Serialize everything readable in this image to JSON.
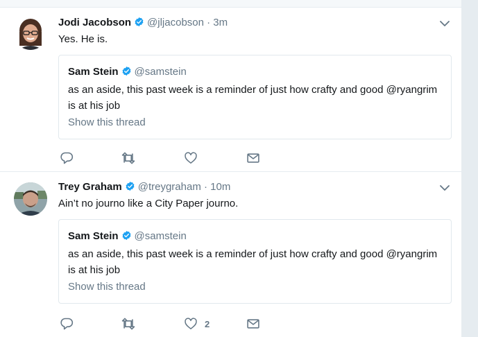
{
  "tweets": [
    {
      "author": {
        "name": "Jodi Jacobson",
        "handle": "@jljacobson",
        "verified": true
      },
      "time": "· 3m",
      "text": "Yes. He is.",
      "quote": {
        "author": {
          "name": "Sam Stein",
          "handle": "@samstein",
          "verified": true
        },
        "text": "as an aside, this past week is a reminder of just how crafty and good @ryangrim is at his job",
        "thread_link": "Show this thread"
      },
      "actions": {
        "reply": "",
        "retweet": "",
        "like": "",
        "dm": ""
      }
    },
    {
      "author": {
        "name": "Trey Graham",
        "handle": "@treygraham",
        "verified": true
      },
      "time": "· 10m",
      "text": "Ain’t no journo like a City Paper journo.",
      "quote": {
        "author": {
          "name": "Sam Stein",
          "handle": "@samstein",
          "verified": true
        },
        "text": "as an aside, this past week is a reminder of just how crafty and good @ryangrim is at his job",
        "thread_link": "Show this thread"
      },
      "actions": {
        "reply": "",
        "retweet": "",
        "like": "2",
        "dm": ""
      }
    }
  ],
  "colors": {
    "verified": "#1da1f2",
    "secondary_text": "#657786",
    "border": "#e1e8ed",
    "background": "#e6ecf0"
  },
  "icons": [
    "verified-badge-icon",
    "caret-down-icon",
    "reply-icon",
    "retweet-icon",
    "like-icon",
    "direct-message-icon"
  ]
}
